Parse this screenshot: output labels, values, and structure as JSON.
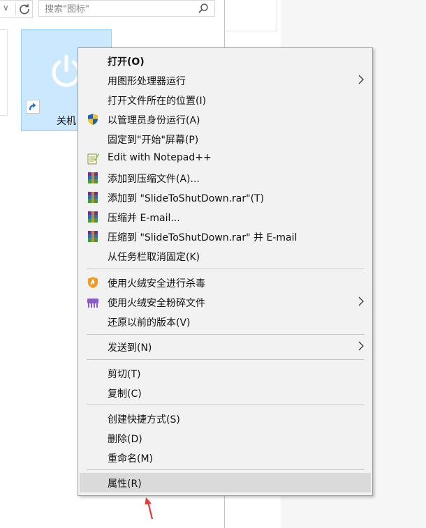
{
  "toolbar": {
    "search_placeholder": "搜索\"图标\""
  },
  "file": {
    "name": "关机"
  },
  "context_menu": {
    "items": [
      {
        "label": "打开(O)",
        "icon": "none",
        "bold": true,
        "submenu": false
      },
      {
        "label": "用图形处理器运行",
        "icon": "none",
        "submenu": true
      },
      {
        "label": "打开文件所在的位置(I)",
        "icon": "none",
        "submenu": false
      },
      {
        "label": "以管理员身份运行(A)",
        "icon": "uac-shield-icon",
        "submenu": false
      },
      {
        "label": "固定到\"开始\"屏幕(P)",
        "icon": "none",
        "submenu": false
      },
      {
        "label": "Edit with Notepad++",
        "icon": "notepadpp-icon",
        "submenu": false
      },
      {
        "label": "添加到压缩文件(A)...",
        "icon": "winrar-icon",
        "submenu": false
      },
      {
        "label": "添加到 \"SlideToShutDown.rar\"(T)",
        "icon": "winrar-icon",
        "submenu": false
      },
      {
        "label": "压缩并 E-mail...",
        "icon": "winrar-icon",
        "submenu": false
      },
      {
        "label": "压缩到 \"SlideToShutDown.rar\" 并 E-mail",
        "icon": "winrar-icon",
        "submenu": false
      },
      {
        "label": "从任务栏取消固定(K)",
        "icon": "none",
        "submenu": false
      },
      {
        "label": "使用火绒安全进行杀毒",
        "icon": "huorong-shield-icon",
        "submenu": false
      },
      {
        "label": "使用火绒安全粉碎文件",
        "icon": "shredder-icon",
        "submenu": true
      },
      {
        "label": "还原以前的版本(V)",
        "icon": "none",
        "submenu": false
      },
      {
        "label": "发送到(N)",
        "icon": "none",
        "submenu": true
      },
      {
        "label": "剪切(T)",
        "icon": "none",
        "submenu": false
      },
      {
        "label": "复制(C)",
        "icon": "none",
        "submenu": false
      },
      {
        "label": "创建快捷方式(S)",
        "icon": "none",
        "submenu": false
      },
      {
        "label": "删除(D)",
        "icon": "none",
        "submenu": false
      },
      {
        "label": "重命名(M)",
        "icon": "none",
        "submenu": false
      },
      {
        "label": "属性(R)",
        "icon": "none",
        "submenu": false,
        "highlighted": true
      }
    ]
  },
  "colors": {
    "selection_bg": "#cce8ff",
    "menu_bg": "#f2f2f2",
    "menu_hover": "#dadada",
    "annotation_arrow": "#e53935"
  }
}
